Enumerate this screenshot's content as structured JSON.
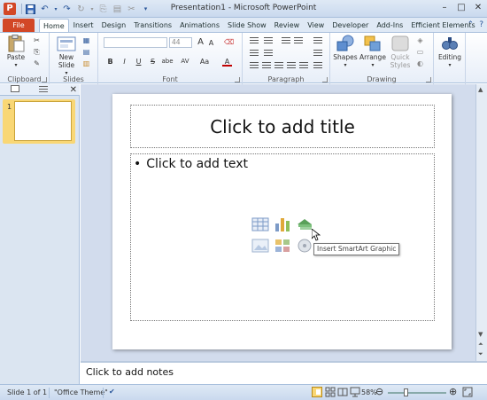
{
  "window": {
    "title": "Presentation1 - Microsoft PowerPoint",
    "app_icon_letter": "P",
    "controls": [
      "–",
      "□",
      "✕"
    ]
  },
  "ribbon_tabs": {
    "file": "File",
    "items": [
      "Home",
      "Insert",
      "Design",
      "Transitions",
      "Animations",
      "Slide Show",
      "Review",
      "View",
      "Developer",
      "Add-Ins",
      "Efficient Elements"
    ],
    "active": "Home"
  },
  "ribbon": {
    "clipboard": {
      "label": "Clipboard",
      "paste": "Paste"
    },
    "slides": {
      "label": "Slides",
      "new_slide": "New Slide"
    },
    "font": {
      "label": "Font",
      "font_size": "44",
      "bold": "B",
      "italic": "I",
      "underline": "U",
      "strike": "S",
      "shadow": "abe",
      "spacing": "AV",
      "case": "Aa",
      "color": "A",
      "grow": "A",
      "shrink": "A"
    },
    "paragraph": {
      "label": "Paragraph"
    },
    "drawing": {
      "label": "Drawing",
      "shapes": "Shapes",
      "arrange": "Arrange",
      "quick_styles": "Quick Styles"
    },
    "editing": {
      "label": "Editing"
    }
  },
  "left_pane": {
    "thumb_number": "1"
  },
  "slide": {
    "title_placeholder": "Click to add title",
    "content_placeholder": "Click to add text",
    "bullet": "•",
    "tooltip": "Insert SmartArt Graphic"
  },
  "notes": {
    "placeholder": "Click to add notes"
  },
  "status": {
    "slide_info": "Slide 1 of 1",
    "theme": "\"Office Theme\"",
    "zoom": "58%"
  },
  "colors": {
    "file_tab": "#d24726",
    "thumb_highlight": "#f9d775",
    "ribbon_bg": "#e7eef8",
    "slide_area_bg": "#d2dced"
  }
}
